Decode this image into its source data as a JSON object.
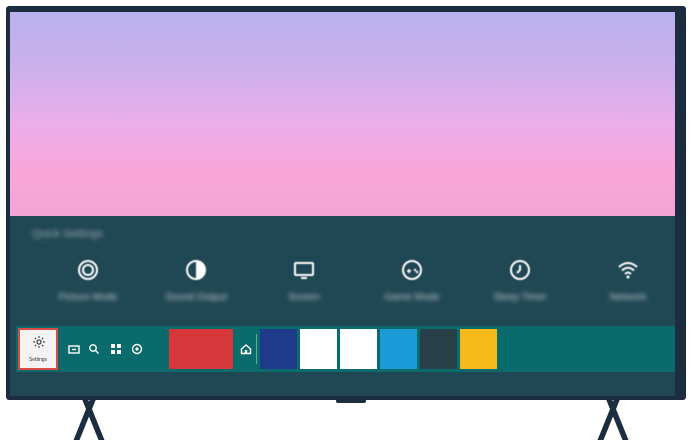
{
  "quick_settings": {
    "title": "Quick Settings",
    "items": [
      {
        "label": "Picture Mode",
        "icon": "picture-mode-icon"
      },
      {
        "label": "Sound Output",
        "icon": "contrast-icon"
      },
      {
        "label": "Screen",
        "icon": "tv-screen-icon"
      },
      {
        "label": "Game Mode",
        "icon": "gamepad-icon"
      },
      {
        "label": "Sleep Timer",
        "icon": "clock-icon"
      },
      {
        "label": "Network",
        "icon": "wifi-icon"
      }
    ]
  },
  "taskbar": {
    "settings_label": "Settings",
    "icons": [
      "source-icon",
      "search-icon",
      "apps-icon",
      "ambient-icon",
      "home-icon"
    ],
    "tile_colors": [
      "#d6373a",
      "#1e3a8a",
      "#ffffff",
      "#ffffff",
      "#1a9ad6",
      "#27404a",
      "#f7b91a"
    ]
  }
}
